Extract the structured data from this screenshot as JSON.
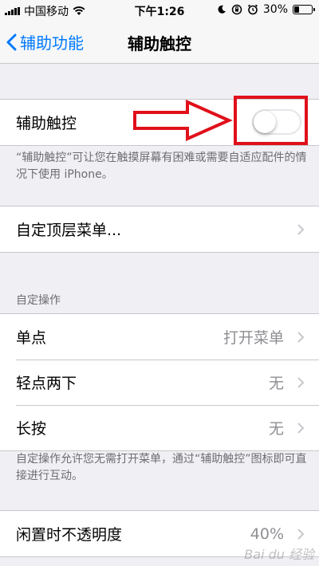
{
  "status_bar": {
    "carrier": "中国移动",
    "time": "下午1:26",
    "battery": "30%",
    "battery_level": 0.3
  },
  "nav": {
    "back_label": "辅助功能",
    "title": "辅助触控"
  },
  "assistive_touch": {
    "label": "辅助触控",
    "enabled": false,
    "note": "“辅助触控”可让您在触摸屏幕有困难或需要自适应配件的情况下使用 iPhone。"
  },
  "top_menu": {
    "label": "自定顶层菜单..."
  },
  "custom_actions": {
    "header": "自定操作",
    "rows": [
      {
        "label": "单点",
        "value": "打开菜单"
      },
      {
        "label": "轻点两下",
        "value": "无"
      },
      {
        "label": "长按",
        "value": "无"
      }
    ],
    "note": "自定操作允许您无需打开菜单，通过“辅助触控”图标即可直接进行互动。"
  },
  "idle_opacity": {
    "label": "闲置时不透明度",
    "value": "40%"
  },
  "colors": {
    "accent": "#007aff",
    "annotation": "#e0101a",
    "background": "#efeff4"
  }
}
